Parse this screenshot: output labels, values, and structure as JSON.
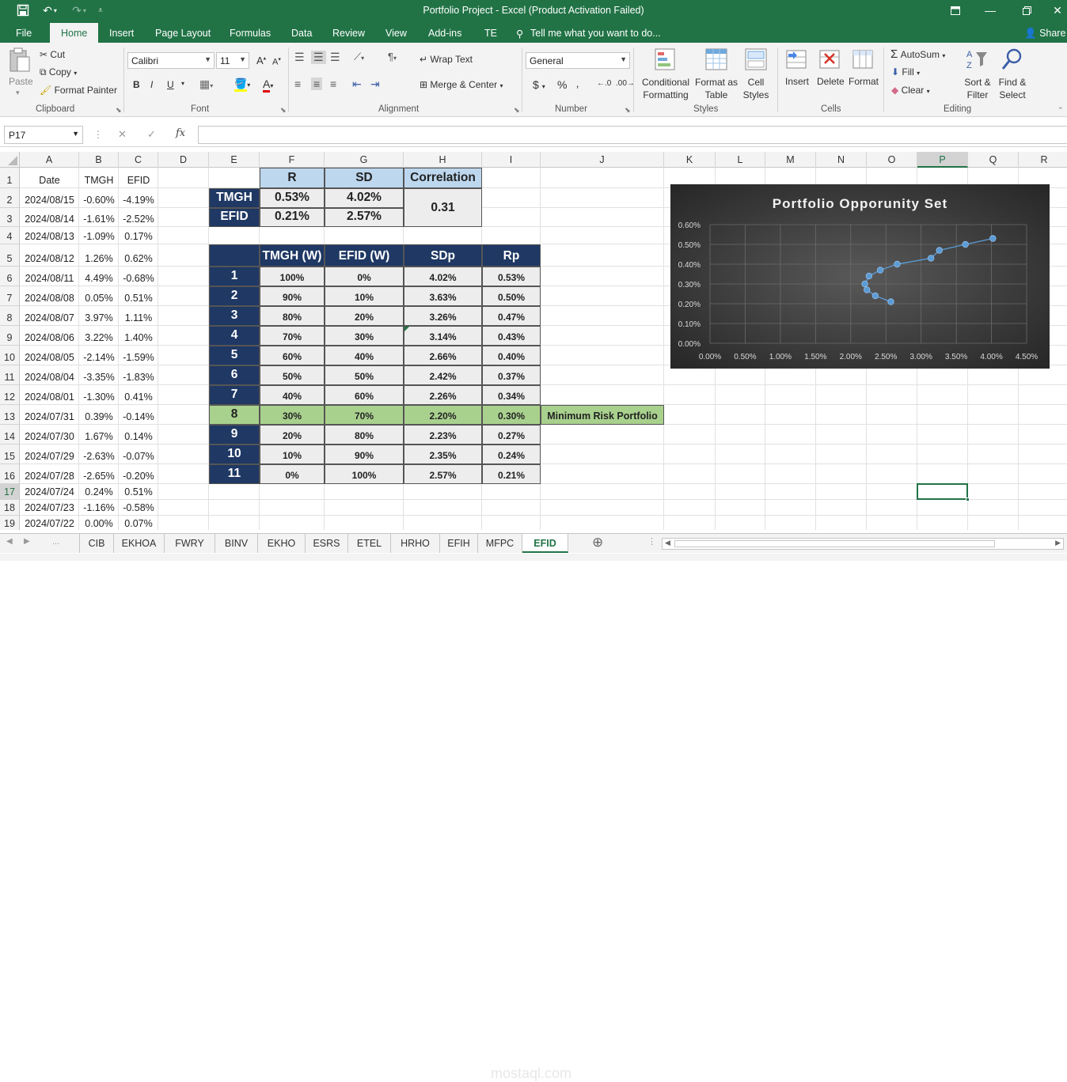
{
  "window": {
    "title": "Portfolio Project - Excel (Product Activation Failed)"
  },
  "menu": {
    "items": [
      "File",
      "Home",
      "Insert",
      "Page Layout",
      "Formulas",
      "Data",
      "Review",
      "View",
      "Add-ins",
      "TE"
    ],
    "tell_me": "Tell me what you want to do...",
    "share": "Share"
  },
  "ribbon": {
    "clipboard": {
      "paste": "Paste",
      "cut": "Cut",
      "copy": "Copy",
      "format_painter": "Format Painter",
      "label": "Clipboard"
    },
    "font": {
      "name": "Calibri",
      "size": "11",
      "bold": "B",
      "italic": "I",
      "underline": "U",
      "label": "Font"
    },
    "alignment": {
      "wrap_text": "Wrap Text",
      "merge_center": "Merge & Center",
      "label": "Alignment"
    },
    "number": {
      "format": "General",
      "currency": "$",
      "percent": "%",
      "comma": "‚",
      "label": "Number"
    },
    "styles": {
      "conditional_formatting": "Conditional Formatting",
      "format_as_table": "Format as Table",
      "cell_styles": "Cell Styles",
      "label": "Styles"
    },
    "cells": {
      "insert": "Insert",
      "delete": "Delete",
      "format": "Format",
      "label": "Cells"
    },
    "editing": {
      "autosum": "AutoSum",
      "fill": "Fill",
      "clear": "Clear",
      "sort_filter": "Sort & Filter",
      "find_select": "Find & Select",
      "label": "Editing"
    }
  },
  "formula_bar": {
    "name_box": "P17",
    "fx": "fx",
    "cancel": "✕",
    "enter": "✓"
  },
  "columns": [
    "A",
    "B",
    "C",
    "D",
    "E",
    "F",
    "G",
    "H",
    "I",
    "J",
    "K",
    "L",
    "M",
    "N",
    "O",
    "P",
    "Q",
    "R"
  ],
  "rows": [
    "1",
    "2",
    "3",
    "4",
    "5",
    "6",
    "7",
    "8",
    "9",
    "10",
    "11",
    "12",
    "13",
    "14",
    "15",
    "16",
    "17",
    "18",
    "19"
  ],
  "date_table": {
    "headers": [
      "Date",
      "TMGH",
      "EFID"
    ],
    "rows": [
      [
        "2024/08/15",
        "-0.60%",
        "-4.19%"
      ],
      [
        "2024/08/14",
        "-1.61%",
        "-2.52%"
      ],
      [
        "2024/08/13",
        "-1.09%",
        "0.17%"
      ],
      [
        "2024/08/12",
        "1.26%",
        "0.62%"
      ],
      [
        "2024/08/11",
        "4.49%",
        "-0.68%"
      ],
      [
        "2024/08/08",
        "0.05%",
        "0.51%"
      ],
      [
        "2024/08/07",
        "3.97%",
        "1.11%"
      ],
      [
        "2024/08/06",
        "3.22%",
        "1.40%"
      ],
      [
        "2024/08/05",
        "-2.14%",
        "-1.59%"
      ],
      [
        "2024/08/04",
        "-3.35%",
        "-1.83%"
      ],
      [
        "2024/08/01",
        "-1.30%",
        "0.41%"
      ],
      [
        "2024/07/31",
        "0.39%",
        "-0.14%"
      ],
      [
        "2024/07/30",
        "1.67%",
        "0.14%"
      ],
      [
        "2024/07/29",
        "-2.63%",
        "-0.07%"
      ],
      [
        "2024/07/28",
        "-2.65%",
        "-0.20%"
      ],
      [
        "2024/07/24",
        "0.24%",
        "0.51%"
      ],
      [
        "2024/07/23",
        "-1.16%",
        "-0.58%"
      ],
      [
        "2024/07/22",
        "0.00%",
        "0.07%"
      ]
    ]
  },
  "stats_table": {
    "headers": [
      "R",
      "SD",
      "Correlation"
    ],
    "rows": [
      [
        "TMGH",
        "0.53%",
        "4.02%"
      ],
      [
        "EFID",
        "0.21%",
        "2.57%"
      ]
    ],
    "correlation": "0.31"
  },
  "portfolio_table": {
    "headers": [
      "TMGH (W)",
      "EFID (W)",
      "SDp",
      "Rp"
    ],
    "rows": [
      [
        "1",
        "100%",
        "0%",
        "4.02%",
        "0.53%"
      ],
      [
        "2",
        "90%",
        "10%",
        "3.63%",
        "0.50%"
      ],
      [
        "3",
        "80%",
        "20%",
        "3.26%",
        "0.47%"
      ],
      [
        "4",
        "70%",
        "30%",
        "3.14%",
        "0.43%"
      ],
      [
        "5",
        "60%",
        "40%",
        "2.66%",
        "0.40%"
      ],
      [
        "6",
        "50%",
        "50%",
        "2.42%",
        "0.37%"
      ],
      [
        "7",
        "40%",
        "60%",
        "2.26%",
        "0.34%"
      ],
      [
        "8",
        "30%",
        "70%",
        "2.20%",
        "0.30%"
      ],
      [
        "9",
        "20%",
        "80%",
        "2.23%",
        "0.27%"
      ],
      [
        "10",
        "10%",
        "90%",
        "2.35%",
        "0.24%"
      ],
      [
        "11",
        "0%",
        "100%",
        "2.57%",
        "0.21%"
      ]
    ],
    "min_risk_label": "Minimum Risk Portfolio",
    "min_risk_row": 8
  },
  "chart_data": {
    "type": "scatter",
    "title": "Portfolio Opporunity Set",
    "x": [
      4.02,
      3.63,
      3.26,
      3.14,
      2.66,
      2.42,
      2.26,
      2.2,
      2.23,
      2.35,
      2.57
    ],
    "y": [
      0.53,
      0.5,
      0.47,
      0.43,
      0.4,
      0.37,
      0.34,
      0.3,
      0.27,
      0.24,
      0.21
    ],
    "xlim": [
      0,
      4.5
    ],
    "ylim": [
      0,
      0.6
    ],
    "xticks": [
      "0.00%",
      "0.50%",
      "1.00%",
      "1.50%",
      "2.00%",
      "2.50%",
      "3.00%",
      "3.50%",
      "4.00%",
      "4.50%"
    ],
    "yticks": [
      "0.00%",
      "0.10%",
      "0.20%",
      "0.30%",
      "0.40%",
      "0.50%",
      "0.60%"
    ],
    "grid": true,
    "colors": {
      "marker": "#5b9bd5",
      "line": "#5b9bd5"
    }
  },
  "sheet_tabs": [
    "CIB",
    "EKHOA",
    "FWRY",
    "BINV",
    "EKHO",
    "ESRS",
    "ETEL",
    "HRHO",
    "EFIH",
    "MFPC",
    "EFID"
  ],
  "active_tab": "EFID",
  "colors": {
    "accent": "#217346",
    "navy": "#1f3864",
    "header_blue": "#bdd7ee",
    "highlight_green": "#a9d18e"
  }
}
